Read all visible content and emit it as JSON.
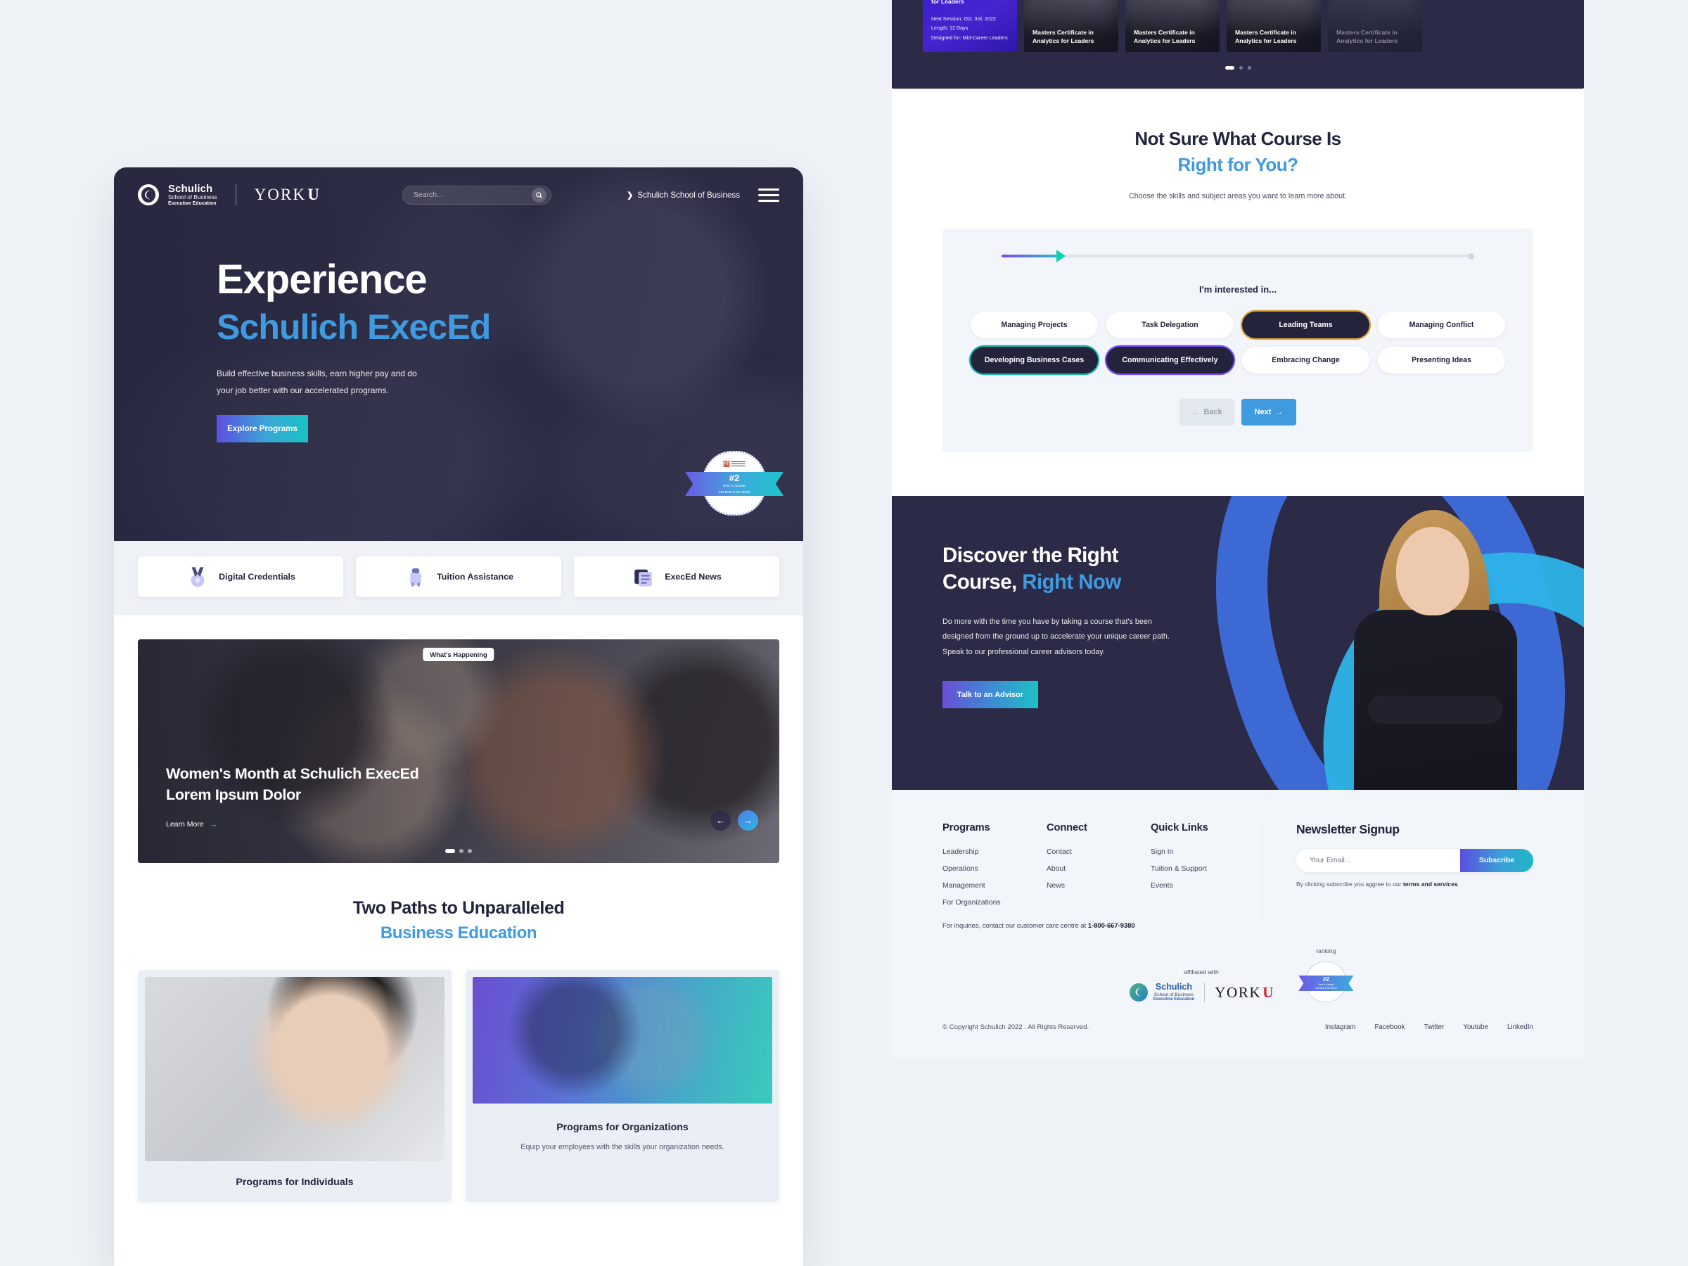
{
  "background_color": "#eff3f7",
  "accent_blue": "#3f9ae0",
  "dark_navy": "#2b2b47",
  "left": {
    "header": {
      "brand": {
        "logo_line1": "Schulich",
        "logo_line2": "School of Business",
        "logo_line3": "Executive Education",
        "york_text": "YORK",
        "york_u": "U"
      },
      "search_placeholder": "Search...",
      "school_link": "Schulich School of Business",
      "chevron": "❯"
    },
    "hero": {
      "title_line1": "Experience",
      "title_line2": "Schulich ExecEd",
      "subtitle": "Build effective business skills, earn higher pay and do your job better with our accelerated programs.",
      "cta_label": "Explore Programs",
      "badge": {
        "rank": "#2",
        "line1": "Best in Canada",
        "line2": "#32 Best in the World",
        "source": "FT"
      }
    },
    "features": [
      {
        "label": "Digital Credentials",
        "icon": "medal-icon"
      },
      {
        "label": "Tuition Assistance",
        "icon": "piggy-bank-icon"
      },
      {
        "label": "ExecEd News",
        "icon": "news-icon"
      }
    ],
    "carousel": {
      "chip": "What's Happening",
      "title_line1": "Women's Month at Schulich ExecEd",
      "title_line2": "Lorem Ipsum Dolor",
      "learn_more": "Learn More",
      "arrow": "→",
      "prev": "←",
      "next": "→",
      "dots": 3,
      "active_dot": 0
    },
    "paths": {
      "heading_line1": "Two Paths to Unparalleled",
      "heading_line2": "Business Education",
      "cards": [
        {
          "label": "Programs for Individuals",
          "desc": ""
        },
        {
          "label": "Programs for Organizations",
          "desc": "Equip your employees with the skills your organization needs."
        }
      ]
    }
  },
  "right": {
    "course_cards": {
      "active": {
        "title": "for Leaders",
        "meta": [
          "Next Session: Oct. 3rd, 2022",
          "Length: 12 Days",
          "Designed for: Mid-Career Leaders"
        ]
      },
      "others": [
        "Masters Certificate in Analytics for Leaders",
        "Masters Certificate in Analytics for Leaders",
        "Masters Certificate in Analytics for Leaders",
        "Masters Certificate in Analytics for Leaders"
      ],
      "dots": 3,
      "active_dot": 0
    },
    "quiz": {
      "heading_line1": "Not Sure What Course Is",
      "heading_line2": "Right for You?",
      "subtitle": "Choose the skills and subject areas you want to learn more about.",
      "question": "I'm interested in...",
      "chips": [
        {
          "label": "Managing Projects",
          "state": "default"
        },
        {
          "label": "Task Delegation",
          "state": "default"
        },
        {
          "label": "Leading Teams",
          "state": "selected-gold"
        },
        {
          "label": "Managing Conflict",
          "state": "default"
        },
        {
          "label": "Developing Business Cases",
          "state": "selected-teal"
        },
        {
          "label": "Communicating Effectively",
          "state": "selected-purple"
        },
        {
          "label": "Embracing Change",
          "state": "default"
        },
        {
          "label": "Presenting Ideas",
          "state": "default"
        }
      ],
      "back_label": "Back",
      "back_arrow": "←",
      "next_label": "Next",
      "next_arrow": "→"
    },
    "discover": {
      "heading_line1": "Discover the Right",
      "heading_line2_a": "Course, ",
      "heading_line2_b": "Right Now",
      "paragraph": "Do more with the time you have by taking a course that's been designed from the ground up to accelerate your unique career path. Speak to our professional career advisors today.",
      "cta_label": "Talk to an Advisor"
    },
    "footer": {
      "columns": [
        {
          "heading": "Programs",
          "links": [
            "Leadership",
            "Operations",
            "Management",
            "For Organizations"
          ]
        },
        {
          "heading": "Connect",
          "links": [
            "Contact",
            "About",
            "News"
          ]
        },
        {
          "heading": "Quick Links",
          "links": [
            "Sign In",
            "Tuition & Support",
            "Events"
          ]
        }
      ],
      "inquiries_prefix": "For inquiries, contact our customer care centre at ",
      "inquiries_phone": "1-800-667-9380",
      "newsletter": {
        "heading": "Newsletter Signup",
        "placeholder": "Your Email...",
        "button": "Subscribe",
        "note_prefix": "By clicking subscribe you aggree to our ",
        "note_terms": "terms and services"
      },
      "affiliated_caption": "affiliated with",
      "ranking_caption": "ranking",
      "affiliated": {
        "schulich_l1": "Schulich",
        "schulich_l2": "School of Business",
        "schulich_l3": "Executive Education",
        "york_text": "YORK",
        "york_u": "U"
      },
      "ranking_badge": {
        "rank": "#2",
        "line1": "Best in Canada",
        "line2": "#32 Best in the World"
      },
      "copyright": "© Copyright Schulich 2022 . All Rights Reserved.",
      "social": [
        "Instagram",
        "Facebook",
        "Twitter",
        "Youtube",
        "LinkedIn"
      ]
    }
  }
}
